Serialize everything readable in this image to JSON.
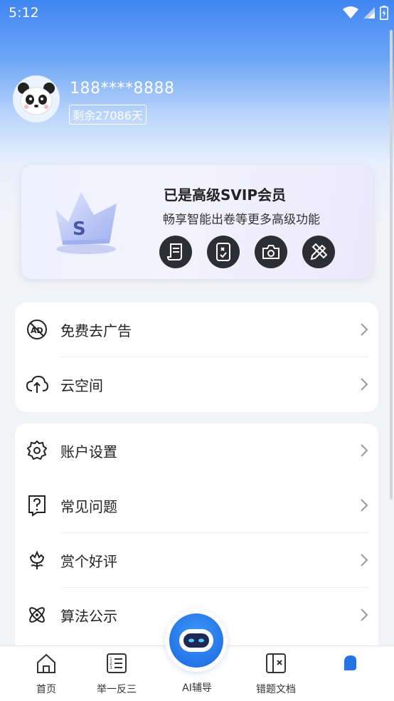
{
  "status_bar": {
    "time": "5:12"
  },
  "profile": {
    "phone": "188****8888",
    "days_left": "剩余27086天"
  },
  "vip": {
    "title": "已是高级SVIP会员",
    "subtitle": "畅享智能出卷等更多高级功能",
    "icons": [
      "document-icon",
      "exam-paper-icon",
      "camera-icon",
      "pencil-ruler-icon"
    ]
  },
  "menu_group_1": [
    {
      "label": "免费去广告",
      "icon": "no-ad-icon"
    },
    {
      "label": "云空间",
      "icon": "cloud-upload-icon"
    }
  ],
  "menu_group_2": [
    {
      "label": "账户设置",
      "icon": "settings-icon"
    },
    {
      "label": "常见问题",
      "icon": "question-icon"
    },
    {
      "label": "赏个好评",
      "icon": "flower-icon"
    },
    {
      "label": "算法公示",
      "icon": "atom-icon"
    }
  ],
  "tabbar": {
    "home": "首页",
    "analogy": "举一反三",
    "ai": "AI辅导",
    "wrong": "错题文档",
    "mine": ""
  },
  "colors": {
    "accent": "#2474e7",
    "header_top": "#3f86f2",
    "icon_dark": "#2d2e33"
  }
}
